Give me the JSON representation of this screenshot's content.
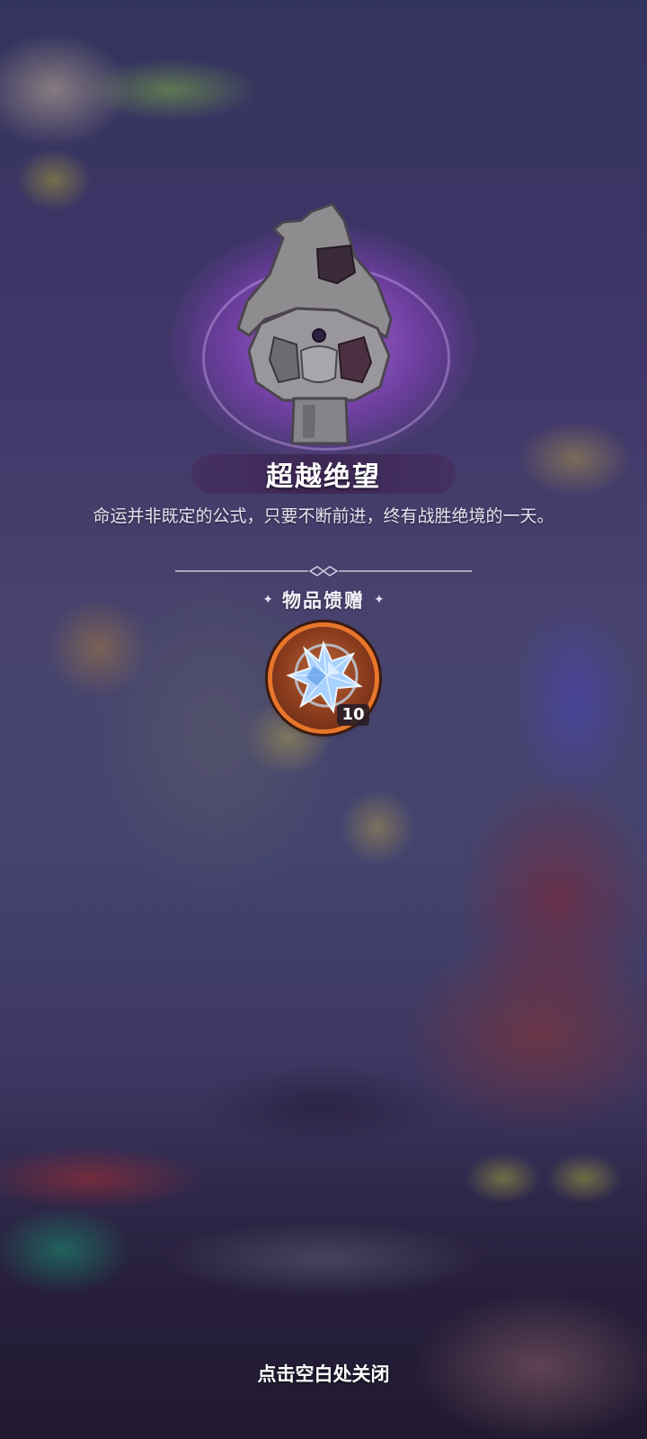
{
  "popup": {
    "title": "超越绝望",
    "description": "命运并非既定的公式，只要不断前进，终有战胜绝境的一天。",
    "gift_section_label": "物品馈赠",
    "reward": {
      "icon": "blue-crystal-icon",
      "count": "10"
    },
    "close_hint": "点击空白处关闭"
  },
  "colors": {
    "title_bar": "#3c2450",
    "item_ring": "#e8762a",
    "glow": "#a64bd6"
  }
}
